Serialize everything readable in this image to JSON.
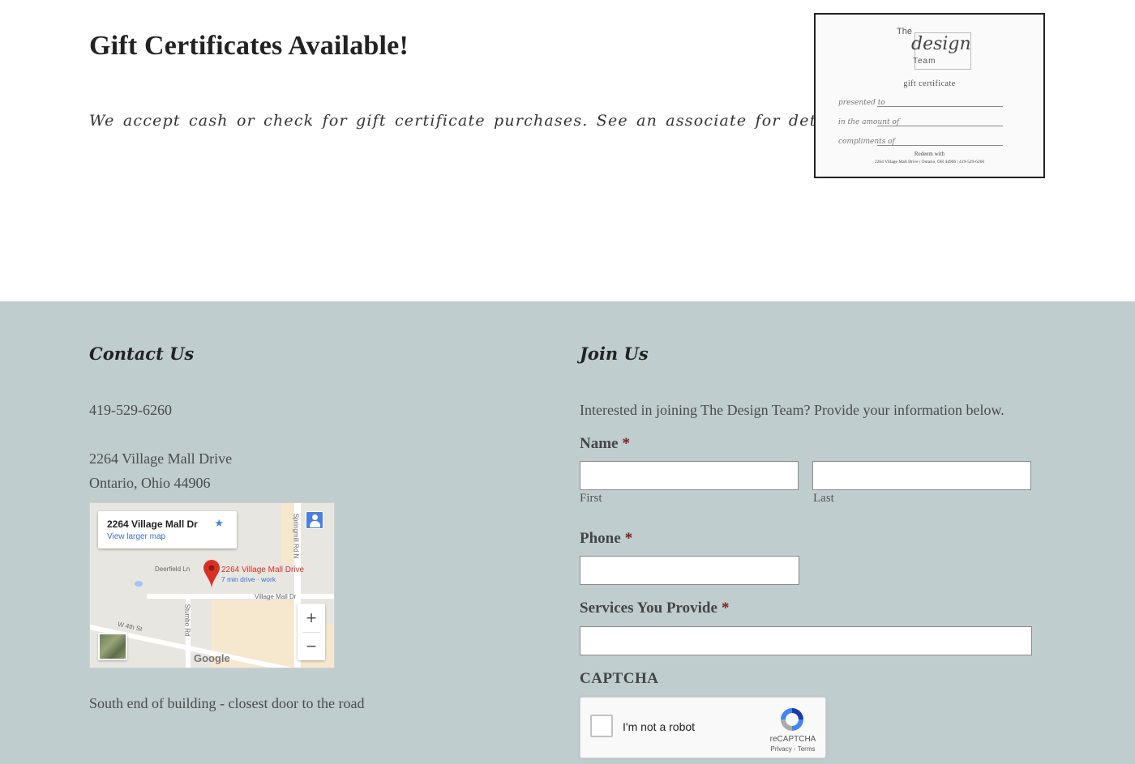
{
  "gift": {
    "title": "Gift Certificates Available!",
    "text": "We accept cash or check for gift certificate purchases. See an associate for details.",
    "certificate": {
      "the": "The",
      "design": "design",
      "team": "Team",
      "subtitle": "gift certificate",
      "rows": [
        "presented to",
        "in the amount of",
        "compliments of"
      ],
      "redeem": "Redeem with",
      "address": "2264 Village Mall Drive | Ontario, OH 44906 | 419-529-6260"
    }
  },
  "contact": {
    "title": "Contact Us",
    "phone": "419-529-6260",
    "address_line1": "2264 Village Mall Drive",
    "address_line2": "Ontario, Ohio 44906",
    "map": {
      "card_title": "2264 Village Mall Dr",
      "card_link": "View larger map",
      "pin_label": "2264 Village Mall Drive",
      "pin_sub": "7 min drive · work",
      "roads": [
        "Deerfield Ln",
        "Village Mall Dr",
        "W 4th St",
        "Stumbo Rd",
        "Springmill Rd N"
      ],
      "zoom_in": "+",
      "zoom_out": "−",
      "brand": "Google"
    },
    "note": "South end of building - closest door to the road"
  },
  "join": {
    "title": "Join Us",
    "intro": "Interested in joining The Design Team? Provide your information below.",
    "name_label": "Name",
    "first_label": "First",
    "last_label": "Last",
    "phone_label": "Phone",
    "services_label": "Services You Provide",
    "required_mark": "*",
    "captcha_label": "CAPTCHA",
    "recaptcha": {
      "checkbox_text": "I'm not a robot",
      "brand": "reCAPTCHA",
      "links": "Privacy - Terms"
    }
  },
  "colors": {
    "footer_bg": "#c0cdcf",
    "required": "#7a1a1a",
    "pin": "#d93025",
    "link": "#3a6fd8"
  },
  "icons": [
    "star-icon",
    "map-pin-icon",
    "person-icon",
    "zoom-in-icon",
    "zoom-out-icon",
    "satellite-thumbnail-icon",
    "recaptcha-logo-icon"
  ]
}
